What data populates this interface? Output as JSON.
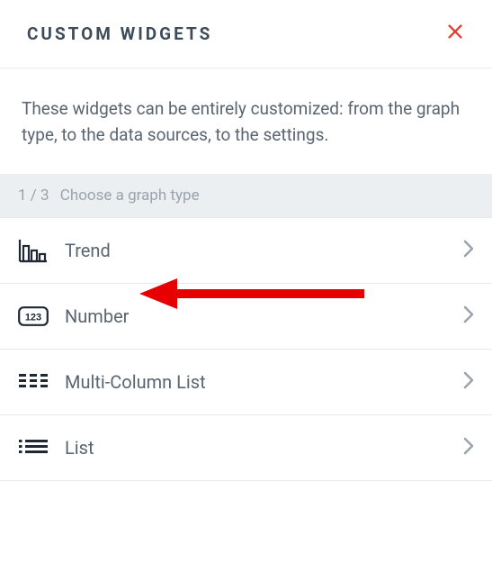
{
  "header": {
    "title": "CUSTOM WIDGETS"
  },
  "description": "These widgets can be entirely customized: from the graph type, to the data sources, to the settings.",
  "step": {
    "counter": "1 / 3",
    "label": "Choose a graph type"
  },
  "items": [
    {
      "label": "Trend"
    },
    {
      "label": "Number"
    },
    {
      "label": "Multi-Column List"
    },
    {
      "label": "List"
    }
  ]
}
